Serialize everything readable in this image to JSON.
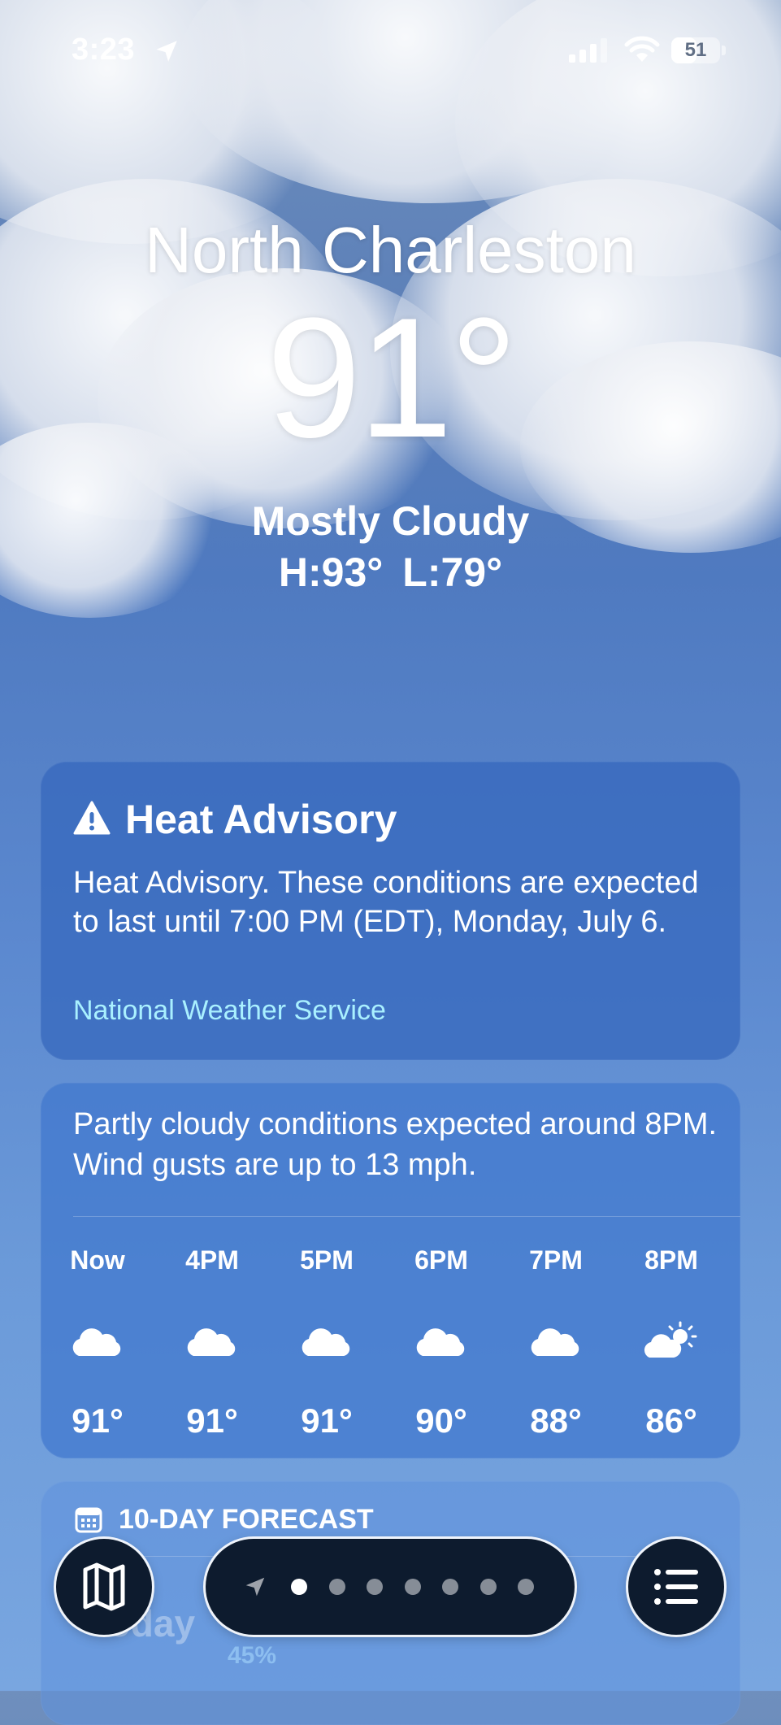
{
  "status_bar": {
    "time": "3:23",
    "battery": "51",
    "battery_level": 0.51
  },
  "location": {
    "city": "North Charleston",
    "temperature": "91°",
    "condition": "Mostly Cloudy",
    "high": "H:93°",
    "low": "L:79°"
  },
  "advisory": {
    "title": "Heat Advisory",
    "body": "Heat Advisory. These conditions are expected to last until 7:00 PM (EDT), Monday, July 6.",
    "source": "National Weather Service"
  },
  "hourly": {
    "summary": "Partly cloudy conditions expected around 8PM. Wind gusts are up to 13 mph.",
    "hours": [
      {
        "label": "Now",
        "icon": "cloud-icon",
        "temp": "91°"
      },
      {
        "label": "4PM",
        "icon": "cloud-icon",
        "temp": "91°"
      },
      {
        "label": "5PM",
        "icon": "cloud-icon",
        "temp": "91°"
      },
      {
        "label": "6PM",
        "icon": "cloud-icon",
        "temp": "90°"
      },
      {
        "label": "7PM",
        "icon": "cloud-icon",
        "temp": "88°"
      },
      {
        "label": "8PM",
        "icon": "partly-sunny-icon",
        "temp": "86°"
      }
    ]
  },
  "ten_day": {
    "title": "10-DAY FORECAST",
    "first_day": "Today",
    "first_day_precip": "45%"
  },
  "pager": {
    "page_count": 7,
    "active_index": 0
  },
  "colors": {
    "accent_source": "#a9f0ff",
    "bar_bg": "#0d1b2e"
  }
}
